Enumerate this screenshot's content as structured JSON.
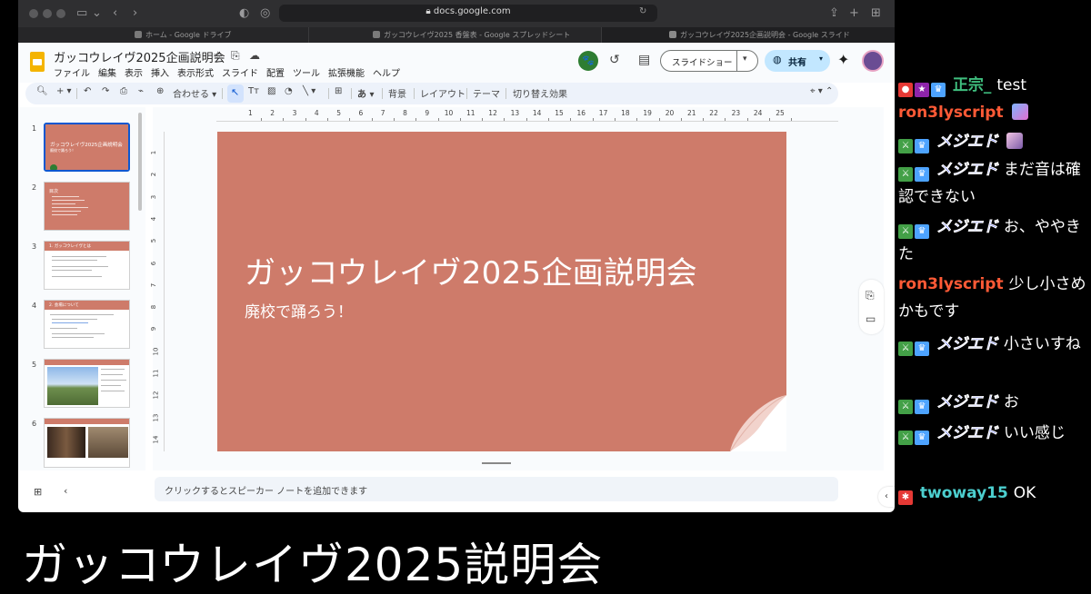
{
  "browser": {
    "url": "docs.google.com",
    "tabs": [
      {
        "label": "ホーム - Google ドライブ",
        "color": "#5f6368"
      },
      {
        "label": "ガッコウレイヴ2025 香盤表 - Google スプレッドシート",
        "color": "#5f6368"
      },
      {
        "label": "ガッコウレイヴ2025企画説明会 - Google スライド",
        "color": "#5f6368"
      }
    ]
  },
  "app": {
    "doc_title": "ガッコウレイヴ2025企画説明会",
    "menu": [
      "ファイル",
      "編集",
      "表示",
      "挿入",
      "表示形式",
      "スライド",
      "配置",
      "ツール",
      "拡張機能",
      "ヘルプ"
    ],
    "slideshow_label": "スライドショー",
    "share_label": "共有",
    "brand_color": "#f4b400",
    "accent": "#0b57d0"
  },
  "toolbar": {
    "zoom_label": "合わせる",
    "bg_label": "背景",
    "layout_label": "レイアウト",
    "theme_label": "テーマ",
    "transition_label": "切り替え効果",
    "text_style_label": "あ"
  },
  "filmstrip": {
    "numbers": [
      "1",
      "2",
      "3",
      "4",
      "5",
      "6"
    ],
    "thumb1_title": "ガッコウレイヴ2025企画説明会",
    "thumb1_sub": "廃校で踊ろう！",
    "thumb2_title": "目次",
    "thumb3_title": "1. ガッコウレイヴとは",
    "thumb4_title": "2. 会場について"
  },
  "ruler": {
    "h_marks": [
      "1",
      "2",
      "3",
      "4",
      "5",
      "6",
      "7",
      "8",
      "9",
      "10",
      "11",
      "12",
      "13",
      "14",
      "15",
      "16",
      "17",
      "18",
      "19",
      "20",
      "21",
      "22",
      "23",
      "24",
      "25"
    ],
    "v_marks": [
      "1",
      "2",
      "3",
      "4",
      "5",
      "6",
      "7",
      "8",
      "9",
      "10",
      "11",
      "12",
      "13",
      "14"
    ]
  },
  "slide": {
    "title": "ガッコウレイヴ2025企画説明会",
    "subtitle": "廃校で踊ろう！",
    "background": "#ce7b6a"
  },
  "notes": {
    "placeholder": "クリックするとスピーカー ノートを追加できます"
  },
  "chat": [
    {
      "user": "正宗_",
      "message": "test",
      "color": "green"
    },
    {
      "user": "ron3lyscript",
      "message": "",
      "color": "red"
    },
    {
      "user": "メジエド",
      "message": "",
      "color": "blue"
    },
    {
      "user": "メジエド",
      "message": "まだ音は確認できない",
      "color": "blue"
    },
    {
      "user": "メジエド",
      "message": "お、ややきた",
      "color": "blue"
    },
    {
      "user": "ron3lyscript",
      "message": "少し小さめかもです",
      "color": "red"
    },
    {
      "user": "メジエド",
      "message": "小さいすね",
      "color": "blue"
    },
    {
      "user": "メジエド",
      "message": "お",
      "color": "blue"
    },
    {
      "user": "メジエド",
      "message": "いい感じ",
      "color": "blue"
    },
    {
      "user": "twoway15",
      "message": "OK",
      "color": "teal"
    }
  ],
  "caption": "ガッコウレイヴ2025説明会"
}
